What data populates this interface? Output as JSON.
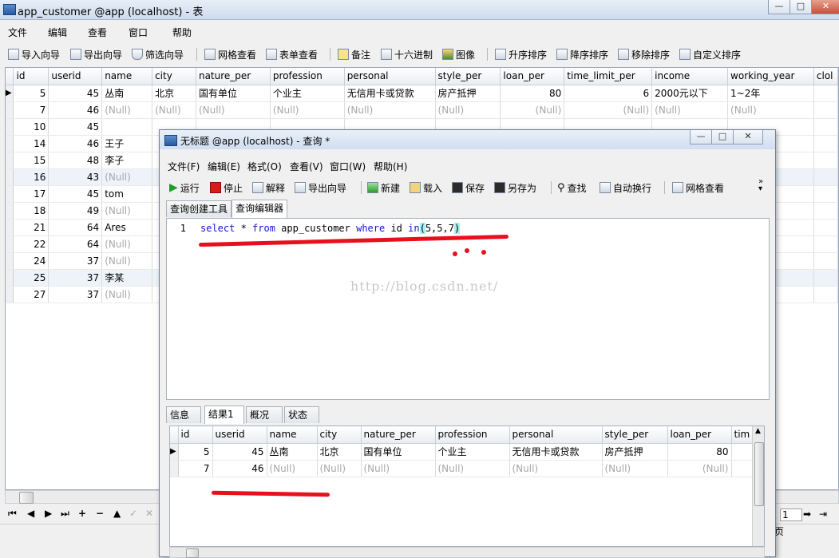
{
  "back_window": {
    "title": "app_customer @app (localhost) - 表",
    "menu": [
      "文件",
      "编辑",
      "查看",
      "窗口",
      "帮助"
    ],
    "toolbar": [
      "导入向导",
      "导出向导",
      "筛选向导",
      "网格查看",
      "表单查看",
      "备注",
      "十六进制",
      "图像",
      "升序排序",
      "降序排序",
      "移除排序",
      "自定义排序"
    ],
    "columns": [
      "id",
      "userid",
      "name",
      "city",
      "nature_per",
      "profession",
      "personal",
      "style_per",
      "loan_per",
      "time_limit_per",
      "income",
      "working_year",
      "clol"
    ],
    "rows": [
      [
        "5",
        "45",
        "丛南",
        "北京",
        "国有单位",
        "个业主",
        "无信用卡或贷款",
        "房产抵押",
        "80",
        "6",
        "2000元以下",
        "1~2年",
        ""
      ],
      [
        "7",
        "46",
        "(Null)",
        "(Null)",
        "(Null)",
        "(Null)",
        "(Null)",
        "(Null)",
        "(Null)",
        "(Null)",
        "(Null)",
        "(Null)",
        ""
      ],
      [
        "10",
        "45",
        "",
        "",
        "",
        "",
        "",
        "",
        "",
        "",
        "",
        "",
        ""
      ],
      [
        "14",
        "46",
        "王子",
        "",
        "",
        "",
        "",
        "",
        "",
        "",
        "",
        "",
        ""
      ],
      [
        "15",
        "48",
        "李子",
        "",
        "",
        "",
        "",
        "",
        "",
        "",
        "",
        "",
        ""
      ],
      [
        "16",
        "43",
        "(Null)",
        "",
        "",
        "",
        "",
        "",
        "",
        "",
        "",
        "",
        ""
      ],
      [
        "17",
        "45",
        "tom",
        "",
        "",
        "",
        "",
        "",
        "",
        "",
        "",
        "",
        ""
      ],
      [
        "18",
        "49",
        "(Null)",
        "",
        "",
        "",
        "",
        "",
        "",
        "",
        "",
        "",
        ""
      ],
      [
        "21",
        "64",
        "Ares",
        "",
        "",
        "",
        "",
        "",
        "",
        "",
        "",
        "",
        ""
      ],
      [
        "22",
        "64",
        "(Null)",
        "",
        "",
        "",
        "",
        "",
        "",
        "",
        "",
        "",
        ""
      ],
      [
        "24",
        "37",
        "(Null)",
        "",
        "",
        "",
        "",
        "",
        "",
        "",
        "",
        "",
        ""
      ],
      [
        "25",
        "37",
        "李某",
        "",
        "",
        "",
        "",
        "",
        "",
        "",
        "",
        "",
        ""
      ],
      [
        "27",
        "37",
        "(Null)",
        "",
        "",
        "",
        "",
        "",
        "",
        "",
        "",
        "",
        ""
      ]
    ],
    "nav_buttons": [
      "⏮",
      "◀",
      "▶",
      "⏭",
      "+",
      "−",
      "▲",
      "✓",
      "✕"
    ],
    "page_number": "1",
    "status_fragment": "页"
  },
  "front_window": {
    "title": "无标题 @app (localhost) - 查询 *",
    "menu": [
      "文件(F)",
      "编辑(E)",
      "格式(O)",
      "查看(V)",
      "窗口(W)",
      "帮助(H)"
    ],
    "toolbar": [
      "运行",
      "停止",
      "解释",
      "导出向导",
      "新建",
      "载入",
      "保存",
      "另存为",
      "查找",
      "自动换行",
      "网格查看"
    ],
    "editor_tabs": [
      "查询创建工具",
      "查询编辑器"
    ],
    "line_number": "1",
    "sql": {
      "t1": "select",
      "t2": " * ",
      "t3": "from",
      "t4": " app_customer ",
      "t5": "where",
      "t6": " id ",
      "t7": "in",
      "t8": "(",
      "t9": "5,5,7",
      "t10": ")"
    },
    "watermark": "http://blog.csdn.net/",
    "result_tabs": [
      "信息",
      "结果1",
      "概况",
      "状态"
    ],
    "result_columns": [
      "id",
      "userid",
      "name",
      "city",
      "nature_per",
      "profession",
      "personal",
      "style_per",
      "loan_per",
      "tim"
    ],
    "result_rows": [
      [
        "5",
        "45",
        "丛南",
        "北京",
        "国有单位",
        "个业主",
        "无信用卡或贷款",
        "房产抵押",
        "80",
        ""
      ],
      [
        "7",
        "46",
        "(Null)",
        "(Null)",
        "(Null)",
        "(Null)",
        "(Null)",
        "(Null)",
        "(Null)",
        ""
      ]
    ]
  },
  "colors": {
    "annotation": "#e8101c",
    "sql_keyword": "#1515d0",
    "null_text": "#a7a7a7"
  }
}
